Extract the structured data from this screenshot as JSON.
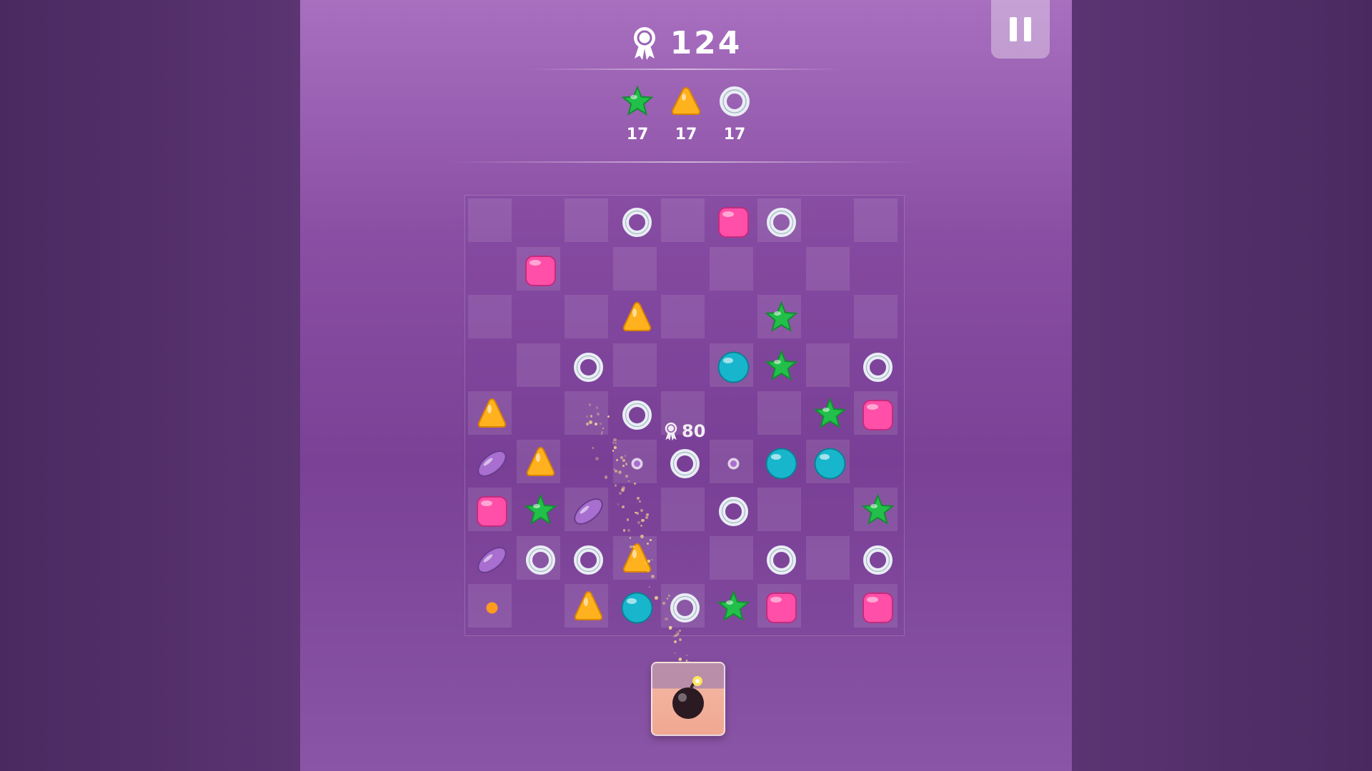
{
  "score": {
    "value": "124",
    "icon": "award-ribbon-icon"
  },
  "pause_button": {
    "icon": "pause-icon"
  },
  "goals": [
    {
      "shape": "star",
      "color": "#22c04a",
      "count": "17"
    },
    {
      "shape": "triangle",
      "color": "#ffb21e",
      "count": "17"
    },
    {
      "shape": "ring",
      "color": "#e8eef5",
      "count": "17"
    }
  ],
  "points_popup": {
    "value": "80",
    "icon": "award-ribbon-icon"
  },
  "colors": {
    "star": "#22c04a",
    "triangle": "#ffb21e",
    "ring": "#e8eef5",
    "square": "#ff4fa8",
    "ball": "#18b6cc",
    "oval": "#a86ed0",
    "dot": "#a86ed0",
    "dotorange": "#ff9a1e"
  },
  "board": {
    "rows": 9,
    "cols": 9,
    "cells": [
      [
        "",
        "",
        "",
        "ring",
        "",
        "square",
        "ring",
        "",
        ""
      ],
      [
        "",
        "square",
        "",
        "",
        "",
        "",
        "",
        "",
        ""
      ],
      [
        "",
        "",
        "",
        "triangle",
        "",
        "",
        "star",
        "",
        ""
      ],
      [
        "",
        "",
        "ring",
        "",
        "",
        "ball",
        "star",
        "",
        "ring"
      ],
      [
        "triangle",
        "",
        "",
        "ring",
        "",
        "",
        "",
        "star",
        "square"
      ],
      [
        "oval",
        "triangle",
        "",
        "dot",
        "ring",
        "dot",
        "ball",
        "ball",
        ""
      ],
      [
        "square",
        "star",
        "oval",
        "",
        "",
        "ring",
        "",
        "",
        "star"
      ],
      [
        "oval",
        "ring",
        "ring",
        "triangle",
        "",
        "",
        "ring",
        "",
        "ring"
      ],
      [
        "dotorange",
        "",
        "triangle",
        "ball",
        "ring",
        "star",
        "square",
        "",
        "square"
      ]
    ]
  },
  "launcher": {
    "item": "bomb-icon"
  }
}
